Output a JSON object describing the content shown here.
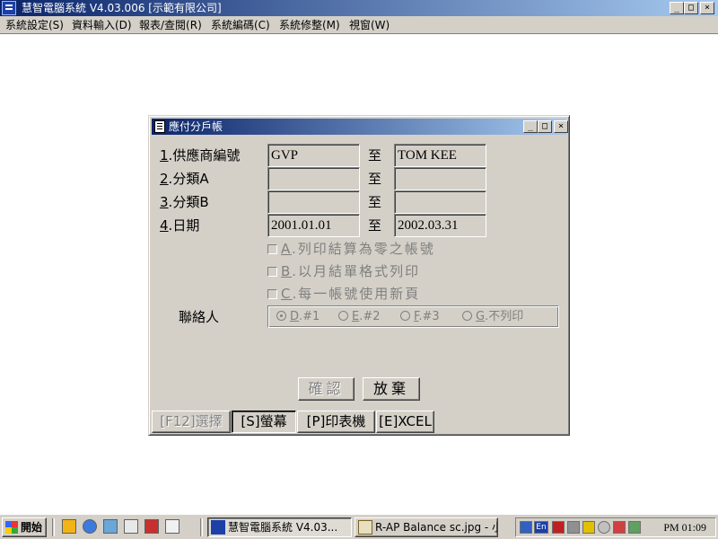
{
  "window": {
    "title": "慧智電腦系統 V4.03.006 [示範有限公司]",
    "buttons": {
      "minimize": "_",
      "maximize": "□",
      "close": "×"
    }
  },
  "menu": [
    {
      "label": "系統設定(S)"
    },
    {
      "label": "資料輸入(D)"
    },
    {
      "label": "報表/查閱(R)"
    },
    {
      "label": "系統編碼(C)"
    },
    {
      "label": "系統修整(M)"
    },
    {
      "label": "視窗(W)"
    }
  ],
  "dialog": {
    "title": "應付分戶帳",
    "buttons": {
      "minimize": "_",
      "maximize": "□",
      "close": "×"
    },
    "fields": [
      {
        "num": "1",
        "label": ".供應商編號",
        "from": "GVP",
        "to": "TOM KEE"
      },
      {
        "num": "2",
        "label": ".分類A",
        "from": "",
        "to": ""
      },
      {
        "num": "3",
        "label": ".分類B",
        "from": "",
        "to": ""
      },
      {
        "num": "4",
        "label": ".日期",
        "from": "2001.01.01",
        "to": "2002.03.31"
      }
    ],
    "to_label": "至",
    "options": [
      {
        "hotkey": "A",
        "label": ".列印結算為零之帳號",
        "checked": false
      },
      {
        "hotkey": "B",
        "label": ".以月結單格式列印",
        "checked": false
      },
      {
        "hotkey": "C",
        "label": ".每一帳號使用新頁",
        "checked": false
      }
    ],
    "contact": {
      "label": "聯絡人",
      "options": [
        {
          "hotkey": "D",
          "label": ".#1",
          "selected": true
        },
        {
          "hotkey": "E",
          "label": ".#2",
          "selected": false
        },
        {
          "hotkey": "F",
          "label": ".#3",
          "selected": false
        },
        {
          "hotkey": "G",
          "label": ".不列印",
          "selected": false
        }
      ]
    },
    "confirm_label": "確認",
    "cancel_label": "放棄",
    "output_buttons": [
      {
        "label": "[F12]選擇",
        "state": "disabled"
      },
      {
        "label": "[S]螢幕",
        "state": "pressed"
      },
      {
        "label": "[P]印表機",
        "state": "normal"
      },
      {
        "label": "[E]XCEL",
        "state": "normal"
      }
    ]
  },
  "taskbar": {
    "start_label": "開始",
    "tasks": [
      {
        "label": "慧智電腦系統 V4.03...",
        "active": true
      },
      {
        "label": "R-AP Balance sc.jpg - 小...",
        "active": false
      }
    ],
    "tray_lang": "En",
    "clock": "PM 01:09"
  }
}
